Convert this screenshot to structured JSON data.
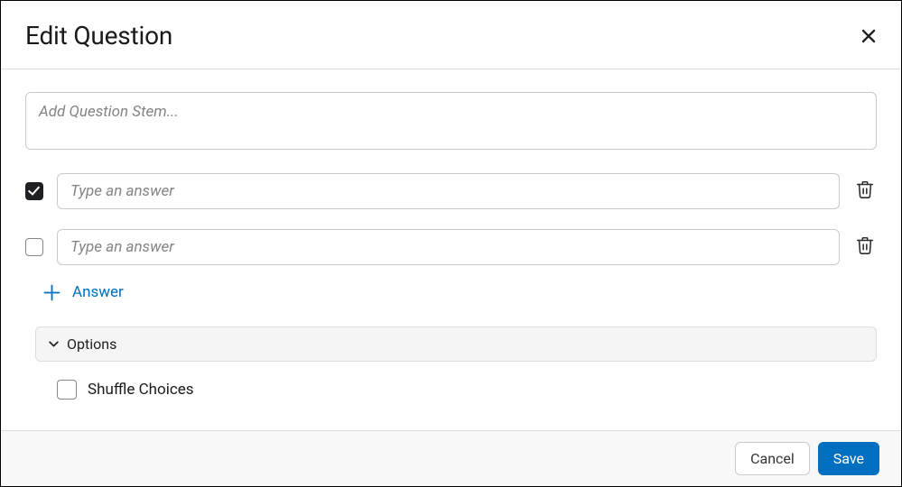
{
  "dialog": {
    "title": "Edit Question"
  },
  "stem": {
    "placeholder": "Add Question Stem...",
    "value": ""
  },
  "answers": [
    {
      "checked": true,
      "value": "",
      "placeholder": "Type an answer"
    },
    {
      "checked": false,
      "value": "",
      "placeholder": "Type an answer"
    }
  ],
  "addAnswer": {
    "label": "Answer"
  },
  "options": {
    "header": "Options",
    "shuffle": {
      "label": "Shuffle Choices",
      "checked": false
    }
  },
  "footer": {
    "cancel": "Cancel",
    "save": "Save"
  }
}
